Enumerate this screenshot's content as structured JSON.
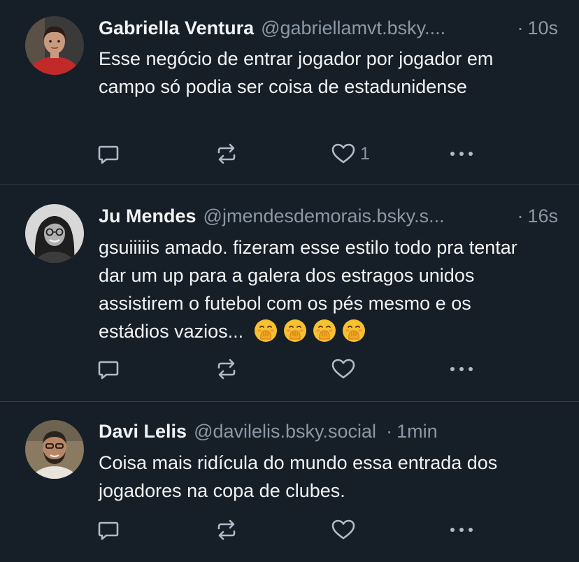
{
  "posts": [
    {
      "author": "Gabriella Ventura",
      "handle": "@gabriellamvt.bsky....",
      "separator": "·",
      "time": "10s",
      "text": "Esse negócio de entrar jogador por jogador em campo só podia ser coisa de estadunidense",
      "like_count": "1",
      "avatar_colors": {
        "bg": "#3a3a3a",
        "skin": "#c99a7e",
        "hair": "#2a1c16",
        "shirt": "#c22a2a"
      }
    },
    {
      "author": "Ju Mendes",
      "handle": "@jmendesdemorais.bsky.s...",
      "separator": "·",
      "time": "16s",
      "text": "gsuiiiiis amado. fizeram esse estilo todo pra tentar dar um up para a galera dos estragos unidos assistirem o futebol com os pés mesmo e os estádios vazios...",
      "emojis": [
        "hand-over-mouth-emoji",
        "hand-over-mouth-emoji",
        "hand-over-mouth-emoji",
        "hand-over-mouth-emoji"
      ],
      "like_count": "",
      "avatar_colors": {
        "bg": "#d8d8d8",
        "skin": "#b0b0b0",
        "hair": "#1e1e1e",
        "shirt": "#3c3c3c"
      }
    },
    {
      "author": "Davi Lelis",
      "handle": "@davilelis.bsky.social",
      "separator": "·",
      "time": "1min",
      "text": "Coisa mais ridícula do mundo essa entrada dos jogadores na copa de clubes.",
      "like_count": "",
      "avatar_colors": {
        "bg": "#8a7a62",
        "skin": "#b88566",
        "hair": "#2b241c",
        "shirt": "#e8e4dc"
      }
    }
  ],
  "icons": {
    "reply": "reply-icon",
    "repost": "repost-icon",
    "like": "heart-icon",
    "more": "more-icon"
  },
  "colors": {
    "background": "#161e27",
    "divider": "#2e4052",
    "text": "#f1f3f5",
    "muted": "#8b98a5",
    "icon": "#aebbc9"
  }
}
